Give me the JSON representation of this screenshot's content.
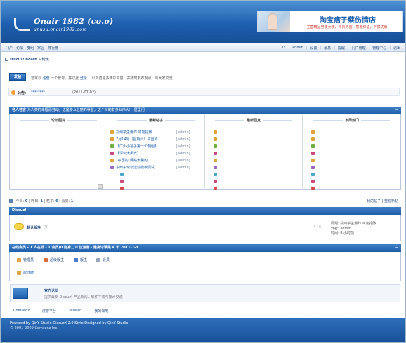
{
  "header": {
    "logo_line1": "Onair 1982 (co.o)",
    "logo_line2": "unusu.onair1982.com",
    "ad_title": "淘宝痞子蔡伤情店",
    "ad_subtitle": "主营精品男装女装，外贸男装，质量保证，折扣优惠!"
  },
  "nav": {
    "left": [
      "门户",
      "论坛",
      "群组",
      "家园",
      "排行榜"
    ],
    "right": [
      "DIY",
      "admin",
      "设置",
      "消息",
      "提醒",
      "门户管理",
      "管理中心",
      "退出"
    ]
  },
  "breadcrumb": "Discuz! Board » 论坛",
  "post_button": "发帖",
  "welcome": {
    "prefix": "您可以",
    "register": "注册",
    "mid1": "一个帐号，并以此",
    "login": "登录",
    "suffix": "，以浏览更多精彩内容，并随时发布观点，与大家交流。"
  },
  "announcement": {
    "label": "公告:",
    "text": "********",
    "date": "(2011-07-02)"
  },
  "recommend": {
    "title": "名人名言",
    "subtitle": "为人类的幸福而劳动，这是多么壮丽的事业，这个目的有多么伟大!　居里门",
    "columns": [
      "论坛图片",
      "最新帖子",
      "最新回复",
      "本周热门"
    ],
    "topics": [
      {
        "title": "郑州学生爆炸 可能招致",
        "author": "[admin]",
        "color": "#e0a23a"
      },
      {
        "title": "7月14号（星期六）中国的",
        "author": "[admin]",
        "color": "#e0a23a"
      },
      {
        "title": "【广州小福子第一个翻组】",
        "author": "[admin]",
        "color": "#6fae43"
      },
      {
        "title": "【深圳大风光】 ...",
        "author": "[admin]",
        "color": "#c94a7d"
      },
      {
        "title": "“中国的”网络大量的...",
        "author": "[admin]",
        "color": "#e0a23a"
      },
      {
        "title": "东西子论坛送动模板测试...",
        "author": "[admin]",
        "color": "#9a6ac2"
      }
    ]
  },
  "recfoot": {
    "labels": [
      "今日:",
      "昨日:",
      "帖子:",
      "会员:"
    ],
    "values": [
      "0",
      "1",
      "6",
      "1"
    ],
    "right": [
      "我的帖子",
      "查看新帖"
    ]
  },
  "discuz": {
    "section_title": "Discuz!",
    "forum_name": "默认版块",
    "count": "(0)",
    "stat": "4 / 6",
    "last_post": [
      "问题: 郑州学生爆炸 可能招致 ...",
      "作者: admin",
      "时间: 8 小时前"
    ]
  },
  "online": {
    "prefix": "在线会员 -",
    "total": "1",
    "mid": "人在线 -",
    "members": "1",
    "mid2": "会员(0 隐身),",
    "guests": "0",
    "suffix": "位游客 - 最高记录是",
    "max": "4",
    "suffix2": "于",
    "date": "2011-7-3.",
    "legend": [
      "管理员",
      "超级版主",
      "版主",
      "会员"
    ],
    "legend_colors": [
      "#e2a24a",
      "#d96b3a",
      "#4c7bc8",
      "#9aa7b8"
    ],
    "user": "admin"
  },
  "official": {
    "name": "官方论坛",
    "desc": "提供最新 Discuz! 产品新闻、软件下载与技术交流"
  },
  "links": [
    "Comsenz",
    "漫游平台",
    "Yeswan",
    "我的领地"
  ],
  "footer": {
    "line1": "Powered by QinY Studio DiscuzX 2.0 Style Designed by QinY Studio",
    "line2": "© 2001-2009 Comsenz Inc."
  }
}
